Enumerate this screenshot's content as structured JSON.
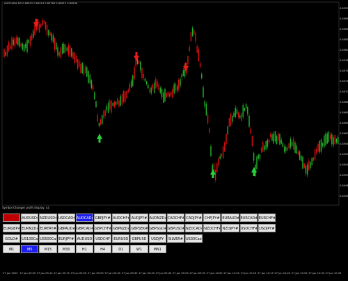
{
  "chart": {
    "symbol_line": "AUDCAD#,M5 0.89812 0.89914 0.89783 0.89812 0.89836",
    "panel_title": "Symbol Changer profit display: v2",
    "price_labels": [
      "0.8990",
      "0.8988",
      "0.8985",
      "0.8983",
      "0.8980",
      "0.8978",
      "0.8975",
      "0.8973",
      "0.8970",
      "0.8968",
      "0.8965",
      "0.8963",
      "0.8960",
      "0.8958",
      "0.8955",
      "0.8953",
      "0.8950",
      "0.8948",
      "0.8945"
    ],
    "time_labels": [
      "27 Jan 2025",
      "27 Jan 09:05",
      "27 Jan 09:10",
      "27 Jan 09:15",
      "27 Jan 09:20",
      "27 Jan 09:25",
      "27 Jan 09:30",
      "27 Jan 09:35",
      "27 Jan 09:40",
      "27 Jan 09:45",
      "27 Jan 09:50",
      "27 Jan 09:55",
      "27 Jan 10:00",
      "27 Jan 10:05",
      "27 Jan 10:10",
      "27 Jan 10:15",
      "27 Jan 10:20",
      "27 Jan 10:25",
      "27 Jan 10:30",
      "27 Jan 10:35"
    ],
    "colors": {
      "bull": "#23b82a",
      "bear": "#e01010",
      "arrow_up": "#28d03a",
      "arrow_down": "#f01a1a"
    }
  },
  "symbols_row1": [
    "AUDCAD#",
    "AUDUSD#",
    "NZDUSD#",
    "USDCAD#",
    "AUDCAD#",
    "GBPJPY#",
    "AUDCHF#",
    "AUDJPY#",
    "AUDNZD#",
    "CADCHF#",
    "CADJPY#",
    "CHFJPY#",
    "EURAUD#",
    "EURCAD#",
    "EURCHF#"
  ],
  "symbols_row2": [
    "EURGBP#",
    "EURNZD#",
    "EURTRY#",
    "GBPAUD#",
    "GBPCAD#",
    "GBPCHF#",
    "GBPNZD#",
    "GBPSEK#",
    "GBPSGD#",
    "GBPUSD#",
    "NZDCAD#",
    "NZDCHF#",
    "NZDJPY#",
    "USDCHF#",
    "USDJPY#"
  ],
  "symbols_row3": [
    "GOLD#",
    "US100Cash",
    "US500Cash",
    "EURJPY#",
    "AUDUSD",
    "USDCHF",
    "EURUSD",
    "GBPUSD",
    "USDJPY",
    "SILVER#",
    "US30Cash"
  ],
  "timeframes": [
    "M1",
    "M5",
    "M15",
    "M30",
    "H1",
    "H4",
    "D1",
    "W1",
    "MN1"
  ],
  "selected": {
    "row1_red_index": 0,
    "row1_blue_index": 4,
    "timeframe_index": 1
  }
}
